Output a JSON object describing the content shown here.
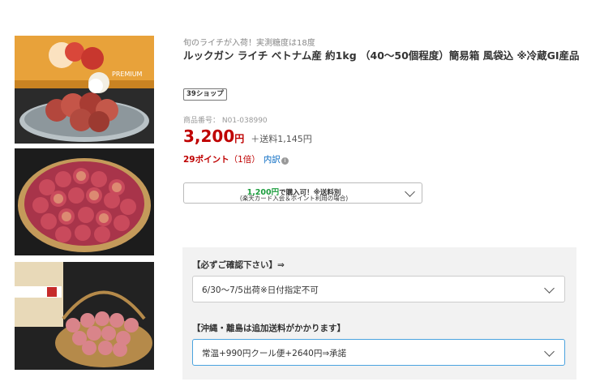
{
  "images": [
    {
      "alt": "ライチ 盛り付け"
    },
    {
      "alt": "ライチ ざる"
    },
    {
      "alt": "ライチ かご"
    }
  ],
  "product": {
    "catch_copy": "旬のライチが入荷！実測糖度は18度",
    "title": "ルックガン ライチ ベトナム産 約1kg （40〜50個程度）簡易箱 風袋込 ※冷蔵GI産品",
    "shop_badge": "39ショップ",
    "item_number": "商品番号：  N01-038990",
    "price": "3,200",
    "price_unit": "円",
    "shipping": "＋送料1,145円",
    "points": "29ポイント",
    "points_multiplier": "（1倍）",
    "breakdown_link": "内訳",
    "breakdown_icon": "info-icon"
  },
  "promo": {
    "amount": "1,200円",
    "line1_suffix": "で購入可！※送料別",
    "line2": "(楽天カード入会＆ポイント利用の場合)"
  },
  "options": {
    "group1": {
      "label": "【必ずご確認下さい】⇒",
      "value": "6/30〜7/5出荷※日付指定不可"
    },
    "group2": {
      "label": "【沖縄・離島は追加送料がかかります】",
      "value": "常温+990円クール便+2640円⇒承諾"
    }
  },
  "colors": {
    "price_red": "#bf0000",
    "promo_green": "#1a9c3c",
    "link_blue": "#0066c0",
    "focus_blue": "#4aa3df"
  }
}
